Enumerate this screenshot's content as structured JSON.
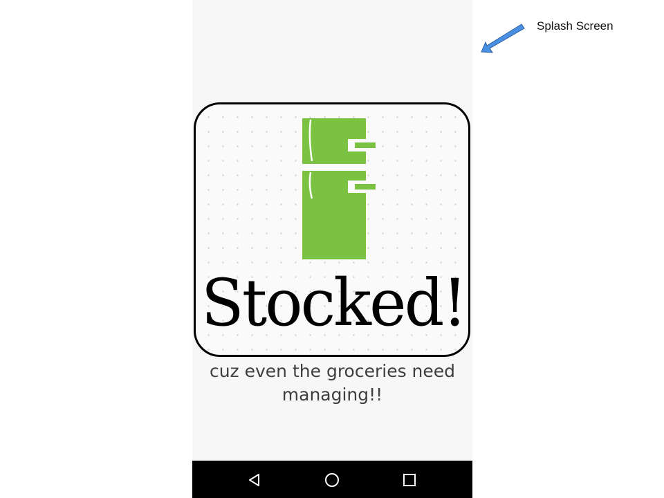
{
  "annotation": {
    "label": "Splash Screen",
    "arrow_color": "#4a90e2"
  },
  "splash": {
    "brand_name": "Stocked!",
    "tagline": "cuz even the groceries need managing!!",
    "logo_icon": "fridge-icon",
    "brand_color": "#7cc242"
  },
  "nav_bar": {
    "buttons": [
      {
        "name": "back",
        "icon": "back-triangle-icon"
      },
      {
        "name": "home",
        "icon": "home-circle-icon"
      },
      {
        "name": "recents",
        "icon": "recents-square-icon"
      }
    ]
  }
}
